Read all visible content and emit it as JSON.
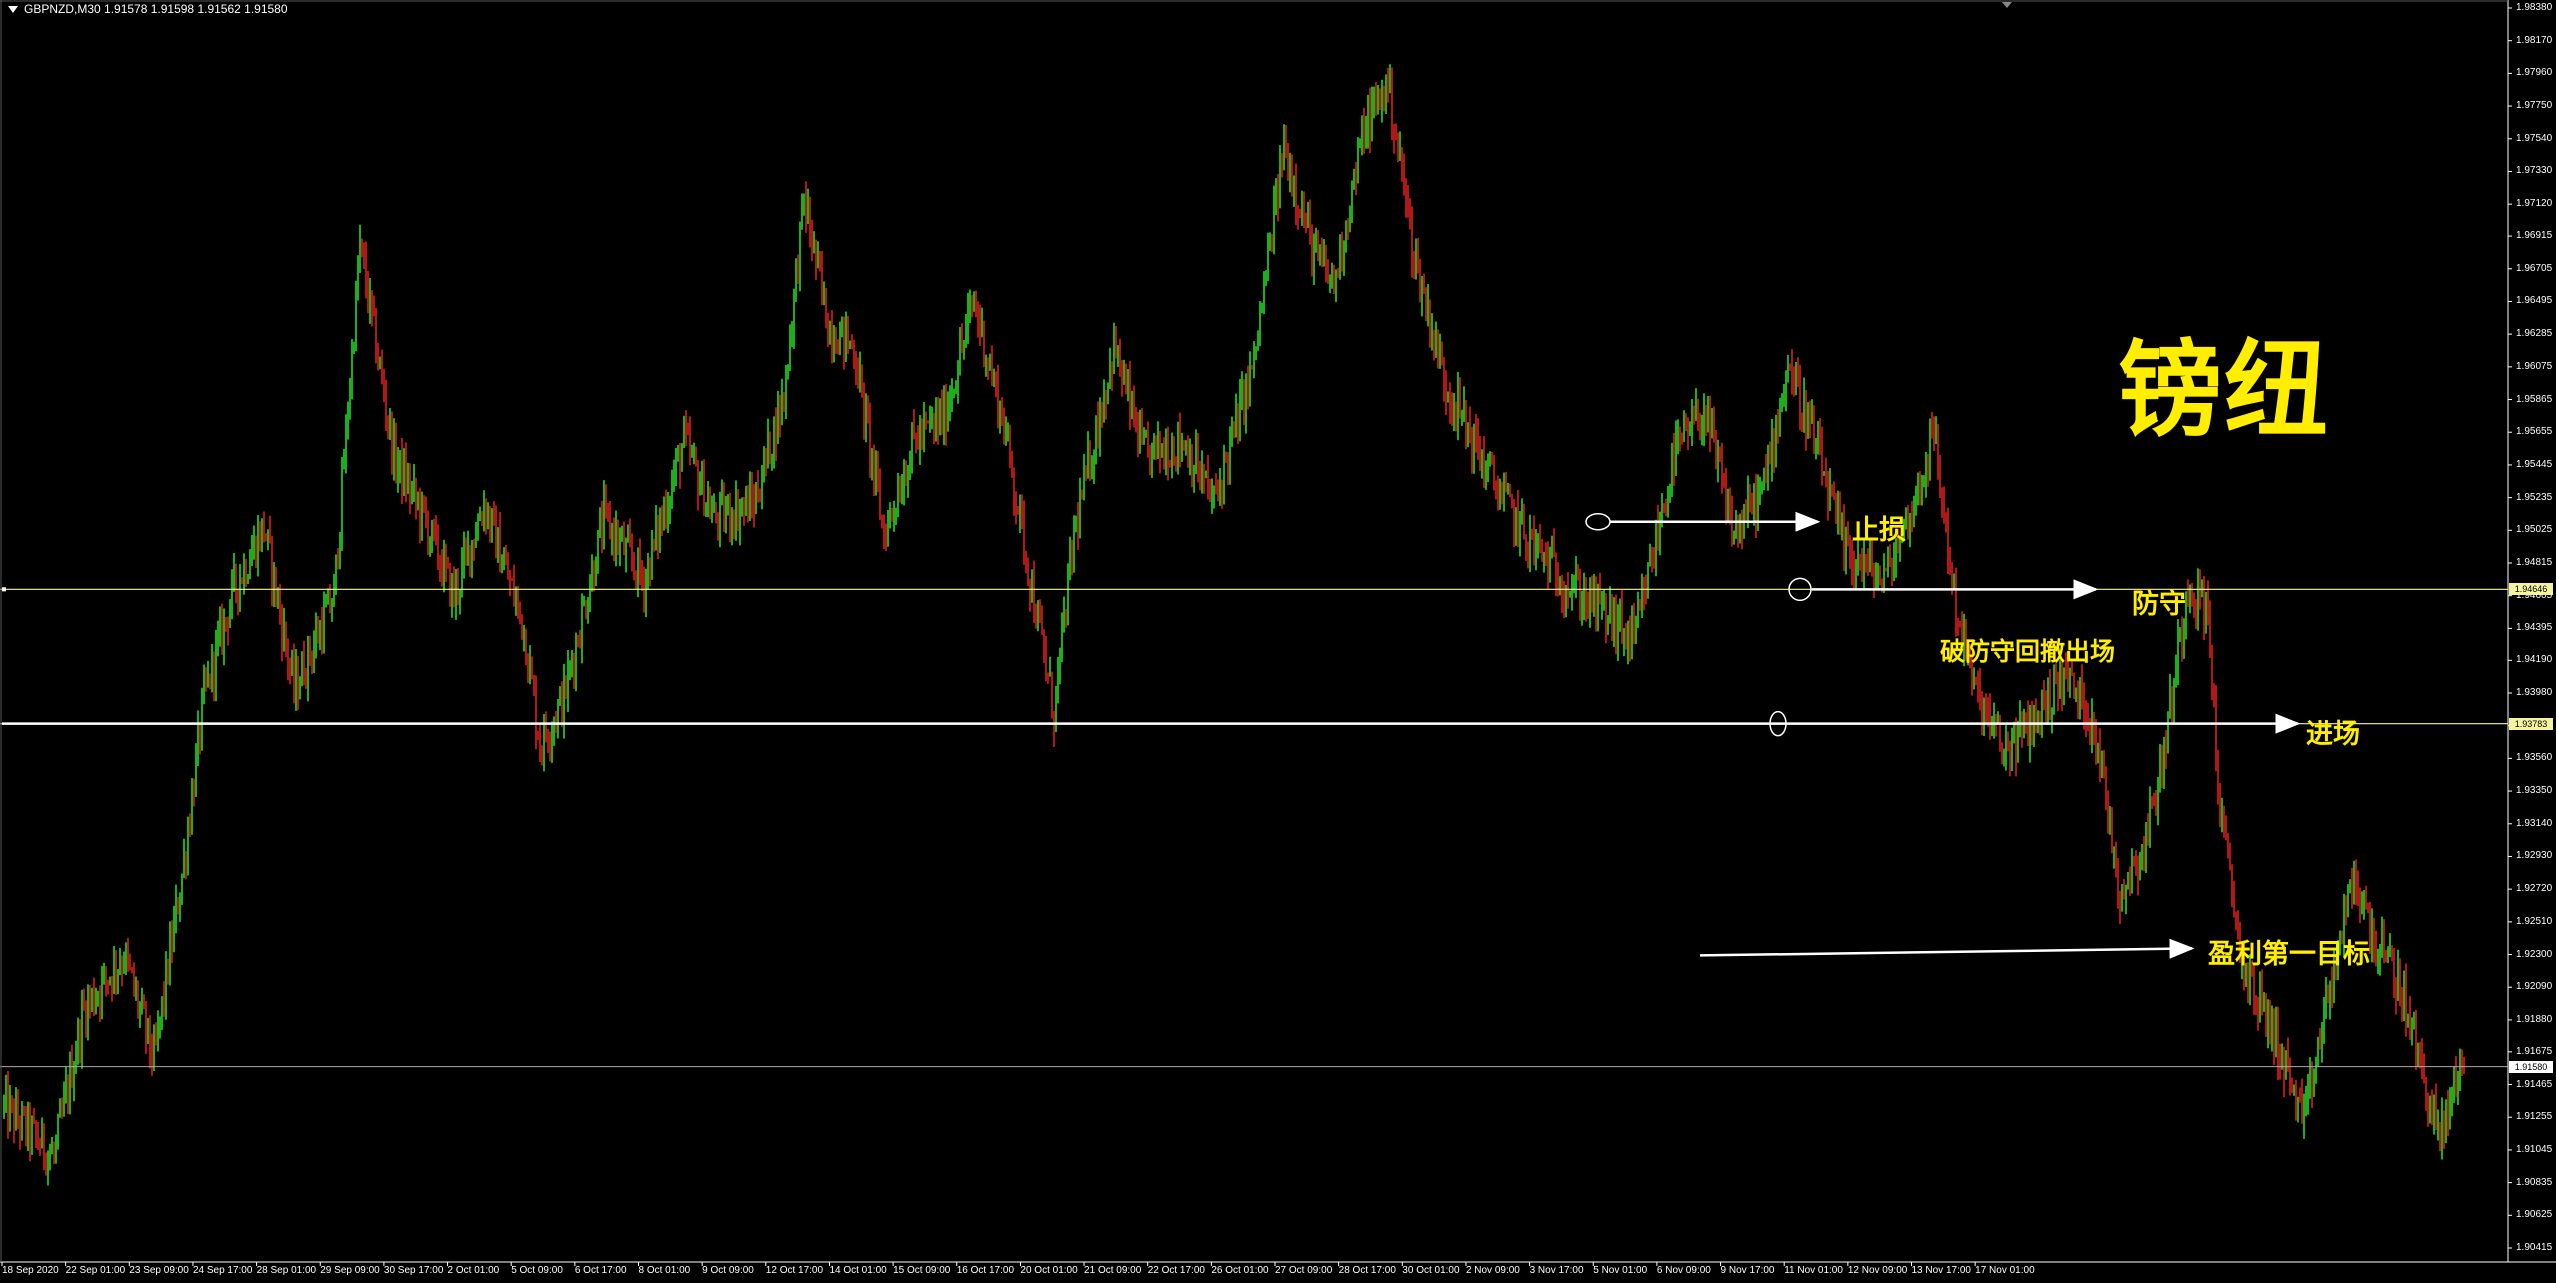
{
  "header": {
    "text": "GBPNZD,M30  1.91578 1.91598 1.91562 1.91580"
  },
  "price_axis": {
    "labels": [
      "1.98380",
      "1.98170",
      "1.97960",
      "1.97750",
      "1.97540",
      "1.97330",
      "1.97120",
      "1.96915",
      "1.96705",
      "1.96495",
      "1.96285",
      "1.96075",
      "1.95865",
      "1.95655",
      "1.95445",
      "1.95235",
      "1.95025",
      "1.94815",
      "1.94605",
      "1.94395",
      "1.94190",
      "1.93980",
      "1.93770",
      "1.93560",
      "1.93350",
      "1.93140",
      "1.92930",
      "1.92720",
      "1.92510",
      "1.92300",
      "1.92090",
      "1.91880",
      "1.91675",
      "1.91465",
      "1.91255",
      "1.91045",
      "1.90835",
      "1.90625",
      "1.90415"
    ],
    "min": 1.90415,
    "max": 1.9838
  },
  "time_axis": {
    "labels": [
      "18 Sep 2020",
      "22 Sep 01:00",
      "23 Sep 09:00",
      "24 Sep 17:00",
      "28 Sep 01:00",
      "29 Sep 09:00",
      "30 Sep 17:00",
      "2 Oct 01:00",
      "5 Oct 09:00",
      "6 Oct 17:00",
      "8 Oct 01:00",
      "9 Oct 09:00",
      "12 Oct 17:00",
      "14 Oct 01:00",
      "15 Oct 09:00",
      "16 Oct 17:00",
      "20 Oct 01:00",
      "21 Oct 09:00",
      "22 Oct 17:00",
      "26 Oct 01:00",
      "27 Oct 09:00",
      "28 Oct 17:00",
      "30 Oct 01:00",
      "2 Nov 09:00",
      "3 Nov 17:00",
      "5 Nov 01:00",
      "6 Nov 09:00",
      "9 Nov 17:00",
      "11 Nov 01:00",
      "12 Nov 09:00",
      "13 Nov 17:00",
      "17 Nov 01:00"
    ]
  },
  "markers": {
    "defense_price": "1.94646",
    "entry_price": "1.93783",
    "current_price": "1.91580"
  },
  "annotations": {
    "title": "镑纽",
    "stop_loss": "止损",
    "defense": "防守",
    "break_defense_exit": "破防守回撤出场",
    "entry": "进场",
    "first_target": "盈利第一目标"
  },
  "colors": {
    "background": "#000000",
    "bull_candle": "#22dd22",
    "bear_candle": "#dd1f1f",
    "axis": "#ffffff",
    "defense_line": "#f4f4a0",
    "entry_line": "#f4f4a0",
    "annotation_text": "#ffee00",
    "arrow": "#ffffff"
  },
  "chart_data": {
    "type": "candlestick",
    "symbol": "GBPNZD",
    "timeframe": "M30",
    "ylim": [
      1.90415,
      1.9838
    ],
    "levels": [
      {
        "label": "止损",
        "value": 1.9508
      },
      {
        "label": "防守",
        "value": 1.94646
      },
      {
        "label": "进场",
        "value": 1.93783
      },
      {
        "label": "盈利第一目标",
        "value": 1.9232
      },
      {
        "value": 1.9158
      }
    ],
    "path": [
      [
        0,
        1.9132
      ],
      [
        25,
        1.91
      ],
      [
        40,
        1.9195
      ],
      [
        60,
        1.923
      ],
      [
        75,
        1.9162
      ],
      [
        90,
        1.929
      ],
      [
        100,
        1.9395
      ],
      [
        115,
        1.9465
      ],
      [
        130,
        1.9505
      ],
      [
        145,
        1.94
      ],
      [
        165,
        1.946
      ],
      [
        178,
        1.9685
      ],
      [
        195,
        1.955
      ],
      [
        210,
        1.951
      ],
      [
        225,
        1.946
      ],
      [
        240,
        1.952
      ],
      [
        260,
        1.944
      ],
      [
        268,
        1.9365
      ],
      [
        280,
        1.9395
      ],
      [
        300,
        1.951
      ],
      [
        320,
        1.947
      ],
      [
        340,
        1.956
      ],
      [
        355,
        1.951
      ],
      [
        375,
        1.952
      ],
      [
        390,
        1.959
      ],
      [
        400,
        1.9715
      ],
      [
        412,
        1.9635
      ],
      [
        425,
        1.962
      ],
      [
        440,
        1.95
      ],
      [
        455,
        1.956
      ],
      [
        470,
        1.9575
      ],
      [
        485,
        1.965
      ],
      [
        500,
        1.957
      ],
      [
        512,
        1.948
      ],
      [
        525,
        1.9385
      ],
      [
        535,
        1.95
      ],
      [
        555,
        1.962
      ],
      [
        570,
        1.955
      ],
      [
        590,
        1.956
      ],
      [
        605,
        1.952
      ],
      [
        625,
        1.961
      ],
      [
        640,
        1.975
      ],
      [
        655,
        1.968
      ],
      [
        665,
        1.966
      ],
      [
        680,
        1.976
      ],
      [
        692,
        1.979
      ],
      [
        705,
        1.968
      ],
      [
        720,
        1.96
      ],
      [
        740,
        1.9545
      ],
      [
        760,
        1.95
      ],
      [
        780,
        1.947
      ],
      [
        800,
        1.945
      ],
      [
        815,
        1.943
      ],
      [
        835,
        1.955
      ],
      [
        850,
        1.958
      ],
      [
        865,
        1.95
      ],
      [
        880,
        1.953
      ],
      [
        892,
        1.961
      ],
      [
        905,
        1.956
      ],
      [
        920,
        1.949
      ],
      [
        940,
        1.947
      ],
      [
        955,
        1.952
      ],
      [
        965,
        1.9565
      ],
      [
        975,
        1.946
      ],
      [
        985,
        1.94
      ],
      [
        1000,
        1.936
      ],
      [
        1015,
        1.938
      ],
      [
        1030,
        1.941
      ],
      [
        1045,
        1.938
      ],
      [
        1058,
        1.927
      ],
      [
        1070,
        1.93
      ],
      [
        1080,
        1.936
      ],
      [
        1092,
        1.947
      ],
      [
        1102,
        1.945
      ],
      [
        1108,
        1.932
      ],
      [
        1120,
        1.922
      ],
      [
        1135,
        1.918
      ],
      [
        1150,
        1.912
      ],
      [
        1160,
        1.919
      ],
      [
        1175,
        1.928
      ],
      [
        1185,
        1.924
      ],
      [
        1198,
        1.921
      ],
      [
        1210,
        1.915
      ],
      [
        1218,
        1.911
      ],
      [
        1230,
        1.917
      ]
    ]
  }
}
